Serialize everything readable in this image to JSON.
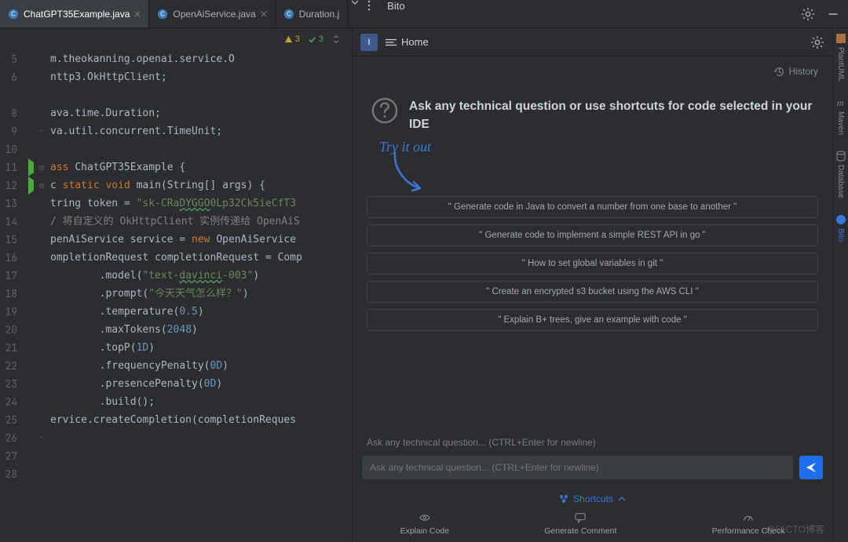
{
  "tabs": [
    {
      "label": "ChatGPT35Example.java",
      "active": true
    },
    {
      "label": "OpenAiService.java",
      "active": false
    },
    {
      "label": "Duration.j",
      "active": false
    }
  ],
  "bitoTitle": "Bito",
  "inspections": {
    "warn": "3",
    "ok": "3"
  },
  "lineNumbers": [
    "5",
    "6",
    "",
    "8",
    "9",
    "10",
    "11",
    "12",
    "13",
    "14",
    "15",
    "16",
    "17",
    "18",
    "19",
    "20",
    "21",
    "22",
    "23",
    "24",
    "25",
    "26",
    "27",
    "28"
  ],
  "code": {
    "l5a": "m.theokanning.openai.service.O",
    "l6": "nttp3.OkHttpClient;",
    "l8": "ava.time.Duration;",
    "l9": "va.util.concurrent.TimeUnit;",
    "l11a": "ass",
    "l11b": " ChatGPT35Example {",
    "l12a": "c ",
    "l12b": "static",
    "l12c": " ",
    "l12d": "void",
    "l12e": " main(String[] args) {",
    "l13a": "tring token = ",
    "l13b": "\"sk-CRa",
    "l13c": "DYGGO",
    "l13d": "0Lp32Ck5ieCfT3",
    "l14a": "/ 将自定义的 OkHttpClient 实例传递给 OpenAiS",
    "l15a": "penAiService service = ",
    "l15b": "new",
    "l15c": " OpenAiService",
    "l16": "ompletionRequest completionRequest = Comp",
    "l17a": "        .model(",
    "l17b": "\"text-",
    "l17c": "davinci",
    "l17d": "-003\"",
    "l17e": ")",
    "l18a": "        .prompt(",
    "l18b": "\"今天天气怎么样？\"",
    "l18c": ")",
    "l19a": "        .temperature(",
    "l19b": "0.5",
    "l19c": ")",
    "l20a": "        .maxTokens(",
    "l20b": "2048",
    "l20c": ")",
    "l21a": "        .topP(",
    "l21b": "1D",
    "l21c": ")",
    "l22a": "        .frequencyPenalty(",
    "l22b": "0D",
    "l22c": ")",
    "l23a": "        .presencePenalty(",
    "l23b": "0D",
    "l23c": ")",
    "l24": "        .build();",
    "l25": "ervice.createCompletion(completionReques"
  },
  "bito": {
    "home": "Home",
    "history": "History",
    "heroText": "Ask any technical question or use shortcuts for code selected in your IDE",
    "tryIt": "Try it out",
    "suggestions": [
      "\" Generate code in Java to convert a number from one base to another \"",
      "\" Generate code to implement a simple REST API in go \"",
      "\" How to set global variables in git \"",
      "\" Create an encrypted s3 bucket using the AWS CLI \"",
      "\" Explain B+ trees, give an example with code \""
    ],
    "placeholder": "Ask any technical question... (CTRL+Enter for newline)",
    "shortcuts": "Shortcuts",
    "tools": [
      "Explain Code",
      "Generate Comment",
      "Performance Check"
    ]
  },
  "rightStrip": [
    "PlantUML",
    "Maven",
    "Database",
    "Bito"
  ],
  "watermark": "@51CTO博客",
  "acctBadge": "I"
}
